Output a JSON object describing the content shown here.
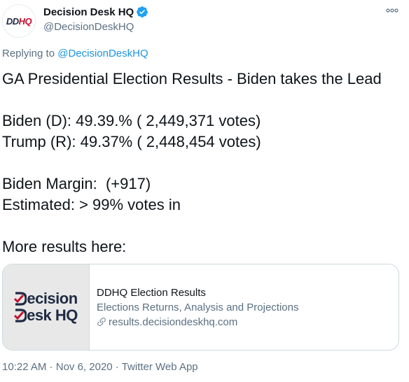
{
  "author": {
    "display_name": "Decision Desk HQ",
    "handle": "@DecisionDeskHQ",
    "avatar_text_a": "DD",
    "avatar_text_b": "HQ"
  },
  "reply": {
    "prefix": "Replying to ",
    "handle": "@DecisionDeskHQ"
  },
  "tweet": {
    "lines": [
      "GA Presidential Election Results - Biden takes the Lead",
      "",
      "Biden (D): 49.39.% ( 2,449,371 votes)",
      "Trump (R): 49.37% ( 2,448,454 votes)",
      "",
      "Biden Margin:  (+917)",
      "Estimated: > 99% votes in",
      "",
      "More results here:"
    ]
  },
  "card": {
    "logo_line1": "ecision",
    "logo_line2": "esk HQ",
    "title": "DDHQ Election Results",
    "description": "Elections Returns, Analysis and Projections",
    "url": "results.decisiondeskhq.com"
  },
  "footer": {
    "time": "10:22 AM",
    "sep1": " · ",
    "date": "Nov 6, 2020",
    "sep2": " · ",
    "source": "Twitter Web App"
  },
  "colors": {
    "link": "#1b95e0",
    "verified": "#1da1f2",
    "brand_navy": "#1f2a44",
    "brand_red": "#c8102e"
  },
  "icons": {
    "verified": "verified-badge-icon",
    "more": "more-options-icon",
    "link": "link-icon"
  }
}
